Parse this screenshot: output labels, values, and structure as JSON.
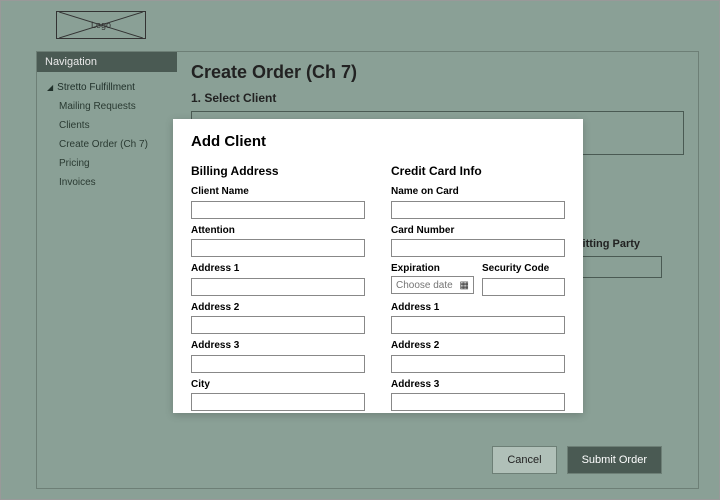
{
  "logo_text": "Logo",
  "nav_header": "Navigation",
  "nav_parent": "Stretto Fulfillment",
  "nav_items": [
    "Mailing Requests",
    "Clients",
    "Create Order (Ch 7)",
    "Pricing",
    "Invoices"
  ],
  "page_title": "Create Order (Ch 7)",
  "section1_title": "1. Select Client",
  "submitting_party_label": "Submitting Party",
  "footer": {
    "cancel": "Cancel",
    "submit": "Submit Order"
  },
  "modal": {
    "title": "Add Client",
    "billing_header": "Billing Address",
    "cc_header": "Credit Card Info",
    "billing_labels": {
      "client_name": "Client Name",
      "attention": "Attention",
      "address1": "Address 1",
      "address2": "Address 2",
      "address3": "Address 3",
      "city": "City"
    },
    "cc_labels": {
      "name_on_card": "Name on Card",
      "card_number": "Card Number",
      "expiration": "Expiration",
      "security_code": "Security Code",
      "expiration_placeholder": "Choose date",
      "address1": "Address 1",
      "address2": "Address 2",
      "address3": "Address 3"
    }
  }
}
